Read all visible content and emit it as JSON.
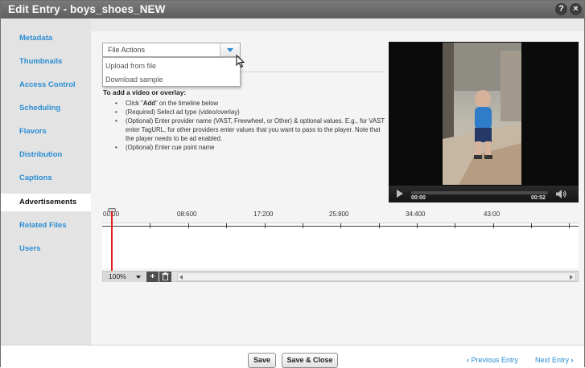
{
  "window": {
    "title": "Edit Entry - boys_shoes_NEW",
    "help_label": "?",
    "close_label": "×"
  },
  "sidebar": {
    "items": [
      {
        "label": "Metadata"
      },
      {
        "label": "Thumbnails"
      },
      {
        "label": "Access Control"
      },
      {
        "label": "Scheduling"
      },
      {
        "label": "Flavors"
      },
      {
        "label": "Distribution"
      },
      {
        "label": "Captions"
      },
      {
        "label": "Advertisements",
        "active": true
      },
      {
        "label": "Related Files"
      },
      {
        "label": "Users"
      }
    ]
  },
  "file_actions": {
    "label": "File Actions",
    "menu": [
      {
        "label": "Upload from file"
      },
      {
        "label": "Download sample"
      }
    ]
  },
  "instructions": {
    "heading": "To add a video or overlay:",
    "steps": [
      {
        "pre": "Click \"",
        "bold": "Add",
        "post": "\" on the timeline below"
      },
      {
        "text": "(Required) Select ad type (video/overlay)"
      },
      {
        "text": "(Optional) Enter provider name (VAST, Freewheel, or Other) & optional values. E.g., for VAST enter TagURL, for other providers enter values that you want to pass to the player. Note that the player needs to be ad enabled."
      },
      {
        "text": "(Optional) Enter cue point name"
      }
    ]
  },
  "player": {
    "current_time": "00:00",
    "duration": "00:52",
    "progress": 0.0,
    "play_icon": "play-icon",
    "volume_icon": "volume-icon"
  },
  "timeline": {
    "labels": [
      "00:00",
      "08:600",
      "17:200",
      "25:800",
      "34:400",
      "43:00"
    ],
    "zoom": "100%",
    "add_label": "+",
    "delete_icon": "trash-icon"
  },
  "footer": {
    "save_label": "Save",
    "save_close_label": "Save & Close",
    "prev_label": "Previous Entry",
    "next_label": "Next Entry",
    "prev_chevron": "‹",
    "next_chevron": "›"
  },
  "colors": {
    "accent": "#2a8dd4",
    "titlebar": "#6a6a6a",
    "playhead": "#e02020"
  }
}
